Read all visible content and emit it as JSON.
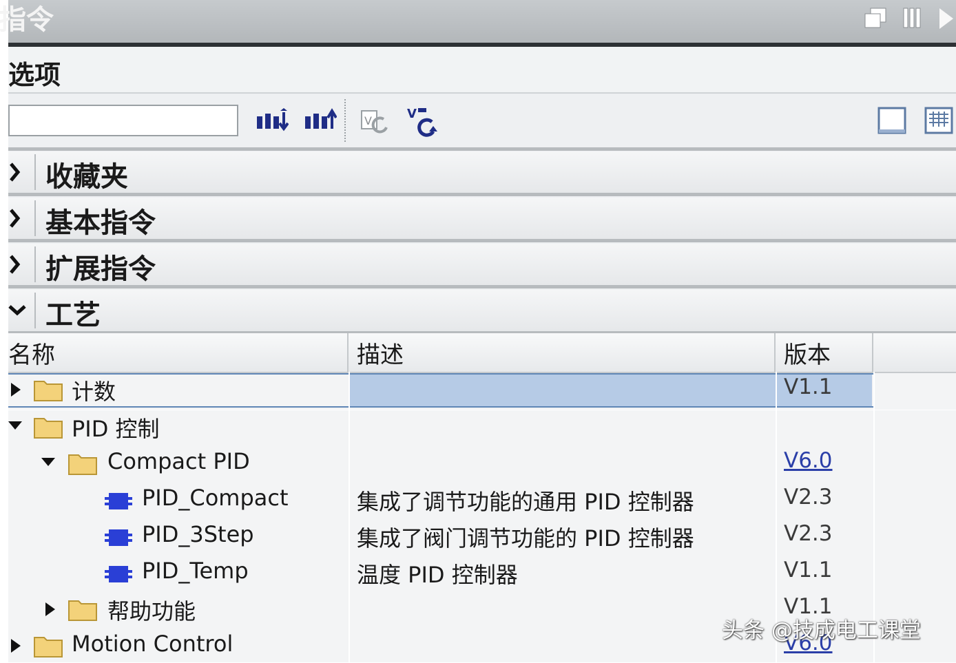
{
  "window": {
    "title": "指令"
  },
  "options": {
    "label": "选项"
  },
  "toolbar": {
    "search_value": "",
    "search_placeholder": ""
  },
  "categories": [
    {
      "label": "收藏夹",
      "expanded": false
    },
    {
      "label": "基本指令",
      "expanded": false
    },
    {
      "label": "扩展指令",
      "expanded": false
    },
    {
      "label": "工艺",
      "expanded": true
    }
  ],
  "table": {
    "columns": [
      "名称",
      "描述",
      "版本"
    ],
    "rows": [
      {
        "name": "计数",
        "desc": "",
        "version": "V1.1",
        "type": "folder",
        "level": 0,
        "expander": "collapsed",
        "selected": true
      },
      {
        "name": "PID 控制",
        "desc": "",
        "version": "",
        "type": "folder",
        "level": 0,
        "expander": "expanded"
      },
      {
        "name": "Compact PID",
        "desc": "",
        "version": "V6.0",
        "type": "folder",
        "level": 1,
        "expander": "expanded",
        "version_link": true
      },
      {
        "name": "PID_Compact",
        "desc": "集成了调节功能的通用 PID 控制器",
        "version": "V2.3",
        "type": "block",
        "level": 2
      },
      {
        "name": "PID_3Step",
        "desc": "集成了阀门调节功能的 PID 控制器",
        "version": "V2.3",
        "type": "block",
        "level": 2
      },
      {
        "name": "PID_Temp",
        "desc": "温度 PID 控制器",
        "version": "V1.1",
        "type": "block",
        "level": 2
      },
      {
        "name": "帮助功能",
        "desc": "",
        "version": "V1.1",
        "type": "folder",
        "level": 1,
        "expander": "collapsed"
      },
      {
        "name": "Motion Control",
        "desc": "",
        "version": "V6.0",
        "type": "folder",
        "level": 0,
        "expander": "collapsed",
        "version_link": true
      }
    ]
  },
  "watermark": "头条 @技成电工课堂",
  "colors": {
    "selection": "#b6cbe6",
    "link": "#2b3fa8",
    "block_icon": "#2a3fd6",
    "folder": "#f3d27a"
  }
}
